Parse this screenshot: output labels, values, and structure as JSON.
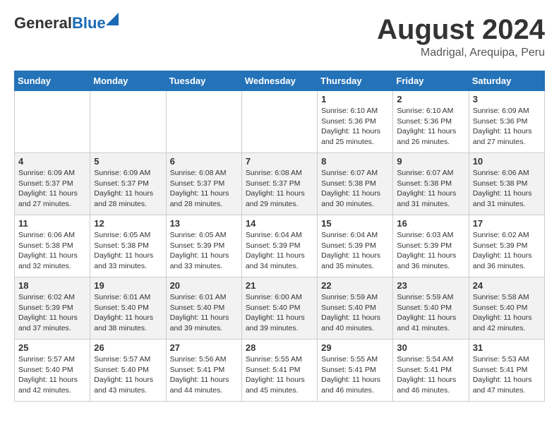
{
  "header": {
    "logo_general": "General",
    "logo_blue": "Blue",
    "main_title": "August 2024",
    "subtitle": "Madrigal, Arequipa, Peru"
  },
  "calendar": {
    "days_of_week": [
      "Sunday",
      "Monday",
      "Tuesday",
      "Wednesday",
      "Thursday",
      "Friday",
      "Saturday"
    ],
    "weeks": [
      [
        {
          "day": "",
          "info": ""
        },
        {
          "day": "",
          "info": ""
        },
        {
          "day": "",
          "info": ""
        },
        {
          "day": "",
          "info": ""
        },
        {
          "day": "1",
          "info": "Sunrise: 6:10 AM\nSunset: 5:36 PM\nDaylight: 11 hours\nand 25 minutes."
        },
        {
          "day": "2",
          "info": "Sunrise: 6:10 AM\nSunset: 5:36 PM\nDaylight: 11 hours\nand 26 minutes."
        },
        {
          "day": "3",
          "info": "Sunrise: 6:09 AM\nSunset: 5:36 PM\nDaylight: 11 hours\nand 27 minutes."
        }
      ],
      [
        {
          "day": "4",
          "info": "Sunrise: 6:09 AM\nSunset: 5:37 PM\nDaylight: 11 hours\nand 27 minutes."
        },
        {
          "day": "5",
          "info": "Sunrise: 6:09 AM\nSunset: 5:37 PM\nDaylight: 11 hours\nand 28 minutes."
        },
        {
          "day": "6",
          "info": "Sunrise: 6:08 AM\nSunset: 5:37 PM\nDaylight: 11 hours\nand 28 minutes."
        },
        {
          "day": "7",
          "info": "Sunrise: 6:08 AM\nSunset: 5:37 PM\nDaylight: 11 hours\nand 29 minutes."
        },
        {
          "day": "8",
          "info": "Sunrise: 6:07 AM\nSunset: 5:38 PM\nDaylight: 11 hours\nand 30 minutes."
        },
        {
          "day": "9",
          "info": "Sunrise: 6:07 AM\nSunset: 5:38 PM\nDaylight: 11 hours\nand 31 minutes."
        },
        {
          "day": "10",
          "info": "Sunrise: 6:06 AM\nSunset: 5:38 PM\nDaylight: 11 hours\nand 31 minutes."
        }
      ],
      [
        {
          "day": "11",
          "info": "Sunrise: 6:06 AM\nSunset: 5:38 PM\nDaylight: 11 hours\nand 32 minutes."
        },
        {
          "day": "12",
          "info": "Sunrise: 6:05 AM\nSunset: 5:38 PM\nDaylight: 11 hours\nand 33 minutes."
        },
        {
          "day": "13",
          "info": "Sunrise: 6:05 AM\nSunset: 5:39 PM\nDaylight: 11 hours\nand 33 minutes."
        },
        {
          "day": "14",
          "info": "Sunrise: 6:04 AM\nSunset: 5:39 PM\nDaylight: 11 hours\nand 34 minutes."
        },
        {
          "day": "15",
          "info": "Sunrise: 6:04 AM\nSunset: 5:39 PM\nDaylight: 11 hours\nand 35 minutes."
        },
        {
          "day": "16",
          "info": "Sunrise: 6:03 AM\nSunset: 5:39 PM\nDaylight: 11 hours\nand 36 minutes."
        },
        {
          "day": "17",
          "info": "Sunrise: 6:02 AM\nSunset: 5:39 PM\nDaylight: 11 hours\nand 36 minutes."
        }
      ],
      [
        {
          "day": "18",
          "info": "Sunrise: 6:02 AM\nSunset: 5:39 PM\nDaylight: 11 hours\nand 37 minutes."
        },
        {
          "day": "19",
          "info": "Sunrise: 6:01 AM\nSunset: 5:40 PM\nDaylight: 11 hours\nand 38 minutes."
        },
        {
          "day": "20",
          "info": "Sunrise: 6:01 AM\nSunset: 5:40 PM\nDaylight: 11 hours\nand 39 minutes."
        },
        {
          "day": "21",
          "info": "Sunrise: 6:00 AM\nSunset: 5:40 PM\nDaylight: 11 hours\nand 39 minutes."
        },
        {
          "day": "22",
          "info": "Sunrise: 5:59 AM\nSunset: 5:40 PM\nDaylight: 11 hours\nand 40 minutes."
        },
        {
          "day": "23",
          "info": "Sunrise: 5:59 AM\nSunset: 5:40 PM\nDaylight: 11 hours\nand 41 minutes."
        },
        {
          "day": "24",
          "info": "Sunrise: 5:58 AM\nSunset: 5:40 PM\nDaylight: 11 hours\nand 42 minutes."
        }
      ],
      [
        {
          "day": "25",
          "info": "Sunrise: 5:57 AM\nSunset: 5:40 PM\nDaylight: 11 hours\nand 42 minutes."
        },
        {
          "day": "26",
          "info": "Sunrise: 5:57 AM\nSunset: 5:40 PM\nDaylight: 11 hours\nand 43 minutes."
        },
        {
          "day": "27",
          "info": "Sunrise: 5:56 AM\nSunset: 5:41 PM\nDaylight: 11 hours\nand 44 minutes."
        },
        {
          "day": "28",
          "info": "Sunrise: 5:55 AM\nSunset: 5:41 PM\nDaylight: 11 hours\nand 45 minutes."
        },
        {
          "day": "29",
          "info": "Sunrise: 5:55 AM\nSunset: 5:41 PM\nDaylight: 11 hours\nand 46 minutes."
        },
        {
          "day": "30",
          "info": "Sunrise: 5:54 AM\nSunset: 5:41 PM\nDaylight: 11 hours\nand 46 minutes."
        },
        {
          "day": "31",
          "info": "Sunrise: 5:53 AM\nSunset: 5:41 PM\nDaylight: 11 hours\nand 47 minutes."
        }
      ]
    ]
  }
}
